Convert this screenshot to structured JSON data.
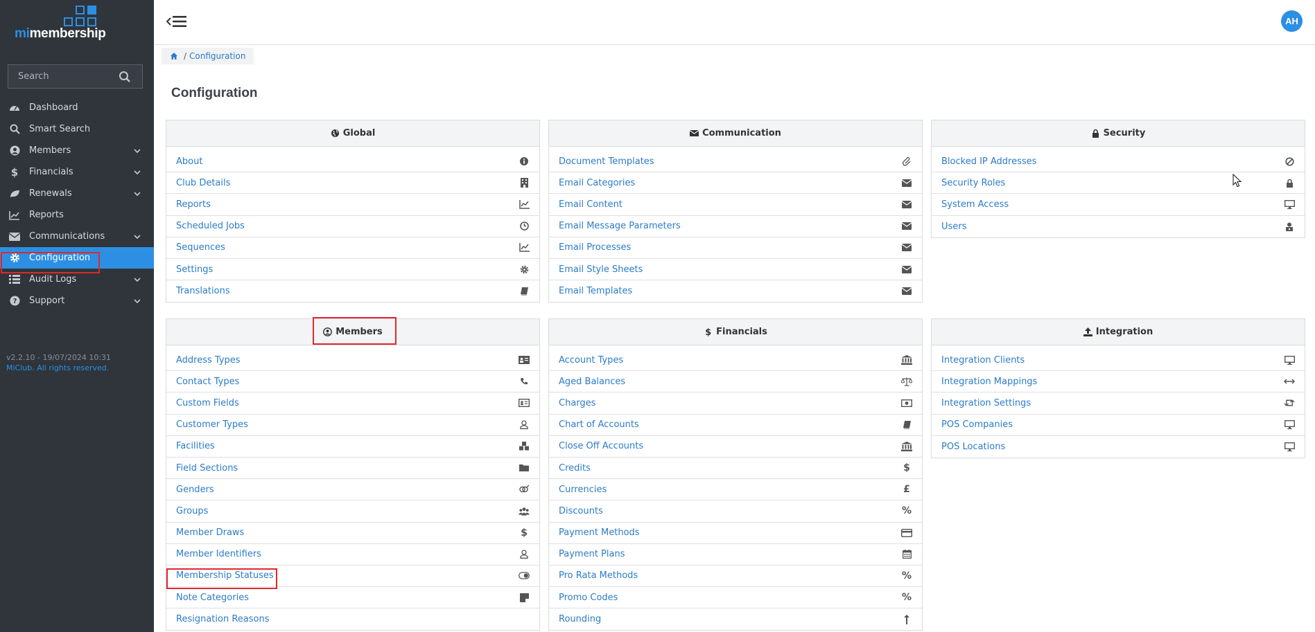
{
  "app": {
    "logo_prefix": "mi",
    "logo_suffix": "membership",
    "version": "v2.2.10 - 19/07/2024 10:31",
    "copyright": "MiClub. All rights reserved.",
    "user_initials": "AH"
  },
  "search": {
    "placeholder": "Search"
  },
  "sidebar": {
    "items": [
      {
        "label": "Dashboard",
        "icon": "dashboard-icon",
        "expandable": false
      },
      {
        "label": "Smart Search",
        "icon": "search-icon",
        "expandable": false
      },
      {
        "label": "Members",
        "icon": "user-circle-icon",
        "expandable": true
      },
      {
        "label": "Financials",
        "icon": "dollar-icon",
        "expandable": true
      },
      {
        "label": "Renewals",
        "icon": "leaf-icon",
        "expandable": true
      },
      {
        "label": "Reports",
        "icon": "chart-line-icon",
        "expandable": false
      },
      {
        "label": "Communications",
        "icon": "envelope-icon",
        "expandable": true
      },
      {
        "label": "Configuration",
        "icon": "gear-icon",
        "expandable": false,
        "active": true
      },
      {
        "label": "Audit Logs",
        "icon": "list-icon",
        "expandable": true
      },
      {
        "label": "Support",
        "icon": "question-icon",
        "expandable": true
      }
    ]
  },
  "breadcrumb": {
    "sep": "/",
    "current": "Configuration"
  },
  "page": {
    "title": "Configuration"
  },
  "panels": {
    "global": {
      "title": "Global",
      "items": [
        {
          "label": "About",
          "icon": "info-icon"
        },
        {
          "label": "Club Details",
          "icon": "building-icon"
        },
        {
          "label": "Reports",
          "icon": "chart-line-icon"
        },
        {
          "label": "Scheduled Jobs",
          "icon": "clock-icon"
        },
        {
          "label": "Sequences",
          "icon": "chart-line-icon"
        },
        {
          "label": "Settings",
          "icon": "gear-icon"
        },
        {
          "label": "Translations",
          "icon": "book-icon"
        }
      ]
    },
    "communication": {
      "title": "Communication",
      "items": [
        {
          "label": "Document Templates",
          "icon": "paperclip-icon"
        },
        {
          "label": "Email Categories",
          "icon": "envelope-icon"
        },
        {
          "label": "Email Content",
          "icon": "envelope-icon"
        },
        {
          "label": "Email Message Parameters",
          "icon": "envelope-icon"
        },
        {
          "label": "Email Processes",
          "icon": "envelope-icon"
        },
        {
          "label": "Email Style Sheets",
          "icon": "envelope-icon"
        },
        {
          "label": "Email Templates",
          "icon": "envelope-icon"
        }
      ]
    },
    "security": {
      "title": "Security",
      "items": [
        {
          "label": "Blocked IP Addresses",
          "icon": "ban-icon"
        },
        {
          "label": "Security Roles",
          "icon": "lock-icon"
        },
        {
          "label": "System Access",
          "icon": "desktop-icon"
        },
        {
          "label": "Users",
          "icon": "user-lock-icon"
        }
      ]
    },
    "members": {
      "title": "Members",
      "items": [
        {
          "label": "Address Types",
          "icon": "address-card-icon"
        },
        {
          "label": "Contact Types",
          "icon": "phone-icon"
        },
        {
          "label": "Custom Fields",
          "icon": "id-card-icon"
        },
        {
          "label": "Customer Types",
          "icon": "user-outline-icon"
        },
        {
          "label": "Facilities",
          "icon": "cubes-icon"
        },
        {
          "label": "Field Sections",
          "icon": "folder-icon"
        },
        {
          "label": "Genders",
          "icon": "genderless-icon"
        },
        {
          "label": "Groups",
          "icon": "users-icon"
        },
        {
          "label": "Member Draws",
          "icon": "dollar-icon"
        },
        {
          "label": "Member Identifiers",
          "icon": "user-outline-icon"
        },
        {
          "label": "Membership Statuses",
          "icon": "toggle-icon"
        },
        {
          "label": "Note Categories",
          "icon": "sticky-note-icon"
        },
        {
          "label": "Resignation Reasons",
          "icon": "none"
        }
      ]
    },
    "financials": {
      "title": "Financials",
      "title_prefix": "$",
      "items": [
        {
          "label": "Account Types",
          "icon": "bank-icon"
        },
        {
          "label": "Aged Balances",
          "icon": "balance-scale-icon"
        },
        {
          "label": "Charges",
          "icon": "money-bill-icon"
        },
        {
          "label": "Chart of Accounts",
          "icon": "book-icon"
        },
        {
          "label": "Close Off Accounts",
          "icon": "bank-icon"
        },
        {
          "label": "Credits",
          "icon": "dollar-icon"
        },
        {
          "label": "Currencies",
          "icon": "pound-icon"
        },
        {
          "label": "Discounts",
          "icon": "percent-icon"
        },
        {
          "label": "Payment Methods",
          "icon": "credit-card-icon"
        },
        {
          "label": "Payment Plans",
          "icon": "calendar-icon"
        },
        {
          "label": "Pro Rata Methods",
          "icon": "percent-icon"
        },
        {
          "label": "Promo Codes",
          "icon": "percent-icon"
        },
        {
          "label": "Rounding",
          "icon": "arrow-up-icon"
        }
      ]
    },
    "integration": {
      "title": "Integration",
      "items": [
        {
          "label": "Integration Clients",
          "icon": "desktop-icon"
        },
        {
          "label": "Integration Mappings",
          "icon": "arrows-h-icon"
        },
        {
          "label": "Integration Settings",
          "icon": "retweet-icon"
        },
        {
          "label": "POS Companies",
          "icon": "desktop-icon"
        },
        {
          "label": "POS Locations",
          "icon": "desktop-icon"
        }
      ]
    }
  },
  "colors": {
    "accent": "#2d8fe3",
    "sidebar_bg": "#2f353b",
    "highlight": "#e0272b",
    "link": "#2b7bc8"
  }
}
